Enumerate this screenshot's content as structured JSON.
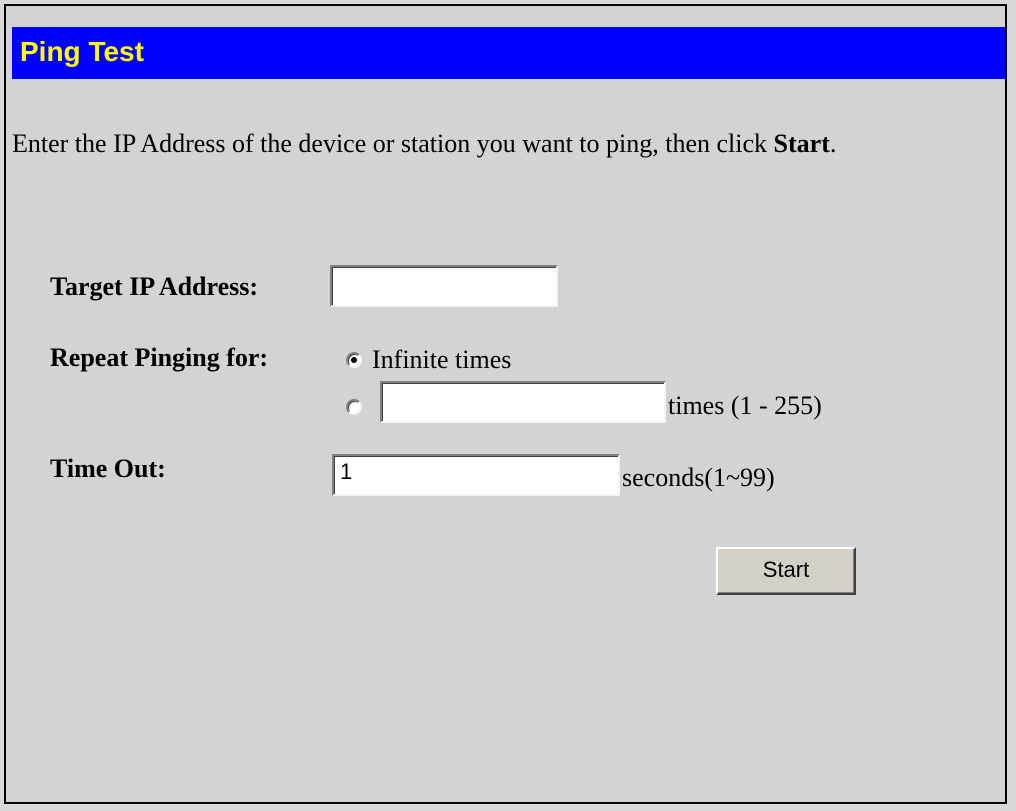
{
  "header": {
    "title": "Ping Test"
  },
  "intro": {
    "text": "Enter the IP Address of the device or station you want to ping, then click ",
    "emphasis": "Start",
    "suffix": "."
  },
  "form": {
    "target_ip": {
      "label": "Target IP Address:",
      "value": ""
    },
    "repeat": {
      "label": "Repeat Pinging for:",
      "option_infinite_label": "Infinite times",
      "option_infinite_selected": true,
      "option_count_selected": false,
      "count_value": "",
      "count_suffix": "times (1 - 255)"
    },
    "timeout": {
      "label": "Time Out:",
      "value": "1",
      "suffix": "seconds(1~99)"
    },
    "start_label": "Start"
  }
}
